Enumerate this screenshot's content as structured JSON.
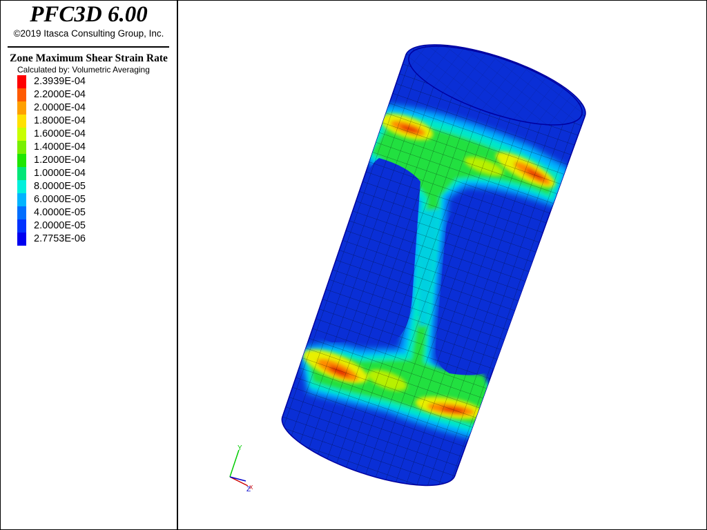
{
  "header": {
    "app_title": "PFC3D 6.00",
    "copyright": "©2019 Itasca Consulting Group, Inc."
  },
  "legend": {
    "title": "Zone Maximum Shear Strain Rate",
    "subtitle": "Calculated by: Volumetric Averaging",
    "entries": [
      {
        "label": "2.3939E-04",
        "color": "#ff0000"
      },
      {
        "label": "2.2000E-04",
        "color": "#ff5a00"
      },
      {
        "label": "2.0000E-04",
        "color": "#ffa000"
      },
      {
        "label": "1.8000E-04",
        "color": "#ffe100"
      },
      {
        "label": "1.6000E-04",
        "color": "#c8ff00"
      },
      {
        "label": "1.4000E-04",
        "color": "#78f000"
      },
      {
        "label": "1.2000E-04",
        "color": "#1ee600"
      },
      {
        "label": "1.0000E-04",
        "color": "#00e678"
      },
      {
        "label": "8.0000E-05",
        "color": "#00f0dc"
      },
      {
        "label": "6.0000E-05",
        "color": "#00b4ff"
      },
      {
        "label": "4.0000E-05",
        "color": "#006eff"
      },
      {
        "label": "2.0000E-05",
        "color": "#0032ff"
      },
      {
        "label": "2.7753E-06",
        "color": "#0000f0"
      }
    ]
  },
  "axes": {
    "y_label": "Y",
    "z_label": "Z",
    "x_label": "X",
    "y_color": "#00cc00",
    "x_color": "#cc0000",
    "z_color": "#0000cc"
  },
  "model": {
    "object": "cylinder-specimen",
    "base_color": "#0a2fd6"
  }
}
